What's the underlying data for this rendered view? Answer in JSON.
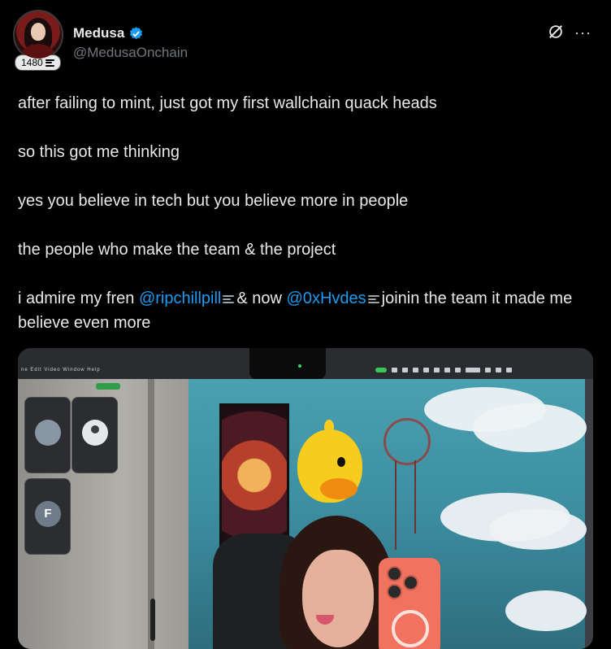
{
  "author": {
    "display_name": "Medusa",
    "handle": "@MedusaOnchain",
    "badge_count": "1480",
    "verified": true
  },
  "colors": {
    "background": "#000000",
    "text": "#e7e9ea",
    "muted": "#71767b",
    "accent": "#1d9bf0"
  },
  "icons": {
    "verified": "verified-badge-icon",
    "grok": "grok-icon",
    "more": "more-options-icon",
    "stack": "stack-icon"
  },
  "tweet": {
    "p1": "after failing to mint, just got my first wallchain quack heads",
    "p2": "so this got me thinking",
    "p3": "yes you believe in tech but you believe more in people",
    "p4": "the people who make the team & the project",
    "p5_a": "i admire my fren ",
    "mention1": "@ripchillpill",
    "p5_b": "& now ",
    "mention2": "@0xHvdes",
    "p5_c": "joinin the team it made me believe even more"
  },
  "media": {
    "menubar_text": "ne Edit Video Window Help",
    "call_tile_letter": "F"
  }
}
